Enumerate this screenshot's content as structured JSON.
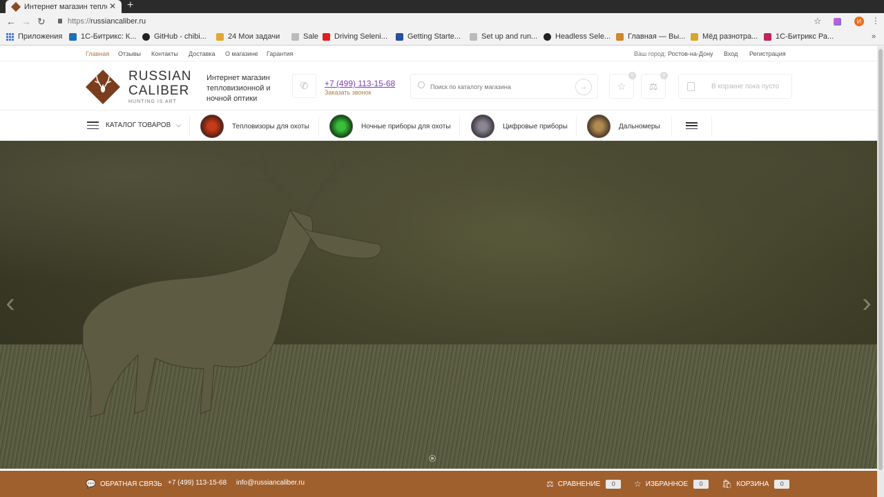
{
  "browser": {
    "tab_title": "Интернет магазин тепло",
    "tab_close": "✕",
    "new_tab": "+",
    "url_scheme": "https://",
    "url_host": "russiancaliber.ru",
    "profile_initial": "И",
    "bookmarks": [
      {
        "label": "Приложения",
        "icon": "apps-icon",
        "color": "#4a7bd1"
      },
      {
        "label": "1С-Битрикс: К...",
        "icon": "bitrix-icon",
        "color": "#1e6fb8"
      },
      {
        "label": "GitHub - chibi...",
        "icon": "github-icon",
        "color": "#222222"
      },
      {
        "label": "24  Мои задачи",
        "icon": "bitrix24-icon",
        "color": "#e5a630"
      },
      {
        "label": "Sale",
        "icon": "page-icon",
        "color": "#bbbbbb"
      },
      {
        "label": "Driving Seleni...",
        "icon": "youtube-icon",
        "color": "#e02020"
      },
      {
        "label": "Getting Starte...",
        "icon": "docs-icon",
        "color": "#2a4fa0"
      },
      {
        "label": "Set up and run...",
        "icon": "page-icon",
        "color": "#bbbbbb"
      },
      {
        "label": "Headless Sele...",
        "icon": "github-icon",
        "color": "#222222"
      },
      {
        "label": "Главная — Вы...",
        "icon": "site-icon",
        "color": "#d4862a"
      },
      {
        "label": "Мёд разнотра...",
        "icon": "honey-icon",
        "color": "#d4a82a"
      },
      {
        "label": "1С-Битрикс Ра...",
        "icon": "bitrix-red-icon",
        "color": "#c0265a"
      }
    ],
    "bookmarks_more": "»"
  },
  "topline": {
    "links": [
      "Главная",
      "Отзывы",
      "Контакты",
      "Доставка",
      "О магазине",
      "Гарантия"
    ],
    "city_label": "Ваш город:",
    "city": "Ростов-на-Дону",
    "login": "Вход",
    "register": "Регистрация"
  },
  "header": {
    "logo_line1": "RUSSIAN",
    "logo_line2": "CALIBER",
    "logo_line3": "HUNTING IS ART",
    "tagline": "Интернет магазин тепловизионной и ночной оптики",
    "phone": "+7 (499) 113-15-68",
    "callback": "Заказать звонок",
    "search_placeholder": "Поиск по каталогу магазина",
    "favorites_count": "0",
    "compare_count": "0",
    "cart_text": "В корзине пока пусто"
  },
  "nav": {
    "catalog": "КАТАЛОГ ТОВАРОВ",
    "items": [
      {
        "label": "Тепловизоры для охоты",
        "color": "#8a2a14"
      },
      {
        "label": "Ночные приборы для охоты",
        "color": "#1f6b1f"
      },
      {
        "label": "Цифровые приборы",
        "color": "#5a5560"
      },
      {
        "label": "Дальномеры",
        "color": "#6b5030"
      }
    ]
  },
  "hero": {
    "prev": "‹",
    "next": "›"
  },
  "footer": {
    "feedback": "ОБРАТНАЯ СВЯЗЬ",
    "phone": "+7 (499) 113-15-68",
    "email": "info@russiancaliber.ru",
    "compare": "СРАВНЕНИЕ",
    "compare_count": "0",
    "favorites": "ИЗБРАННОЕ",
    "favorites_count": "0",
    "cart": "КОРЗИНА",
    "cart_count": "0"
  },
  "colors": {
    "brand_brown": "#a0602e",
    "logo_brown": "#7a3e1e",
    "link_accent": "#b07a4a",
    "phone_link": "#7a3fb0"
  }
}
